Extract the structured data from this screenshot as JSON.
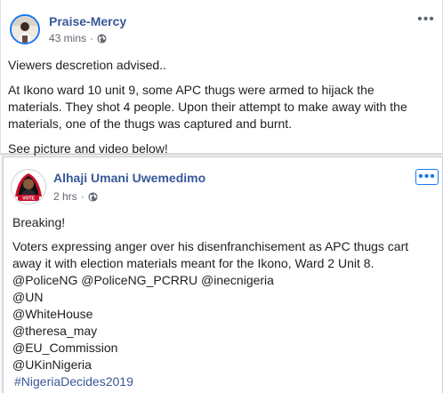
{
  "post1": {
    "author": "Praise-Mercy",
    "time": "43 mins",
    "privacy_icon": "globe-icon",
    "more_label": "•••",
    "lines": [
      "Viewers descretion advised..",
      "At Ikono ward 10 unit 9, some APC thugs were armed to hijack the",
      "materials. They shot 4 people. Upon their attempt to make away with the",
      "materials, one of the thugs was captured and burnt.",
      "See picture and video below!"
    ]
  },
  "post2": {
    "author": "Alhaji Umani Uwemedimo",
    "time": "2 hrs",
    "privacy_icon": "globe-icon",
    "more_label": "•••",
    "avatar_text": "VOTE",
    "lines": [
      "Breaking!",
      "Voters expressing anger over his disenfranchisement as APC thugs cart",
      "away it with election materials meant for the Ikono, Ward 2 Unit 8.",
      "@PoliceNG @PoliceNG_PCRRU @inecnigeria",
      "@UN",
      "@WhiteHouse",
      "@theresa_may",
      "@EU_Commission",
      "@UKinNigeria",
      "#NigeriaDecides2019"
    ]
  },
  "colors": {
    "link": "#385898",
    "accent": "#1877f2",
    "meta": "#616770",
    "text": "#1c1e21"
  }
}
